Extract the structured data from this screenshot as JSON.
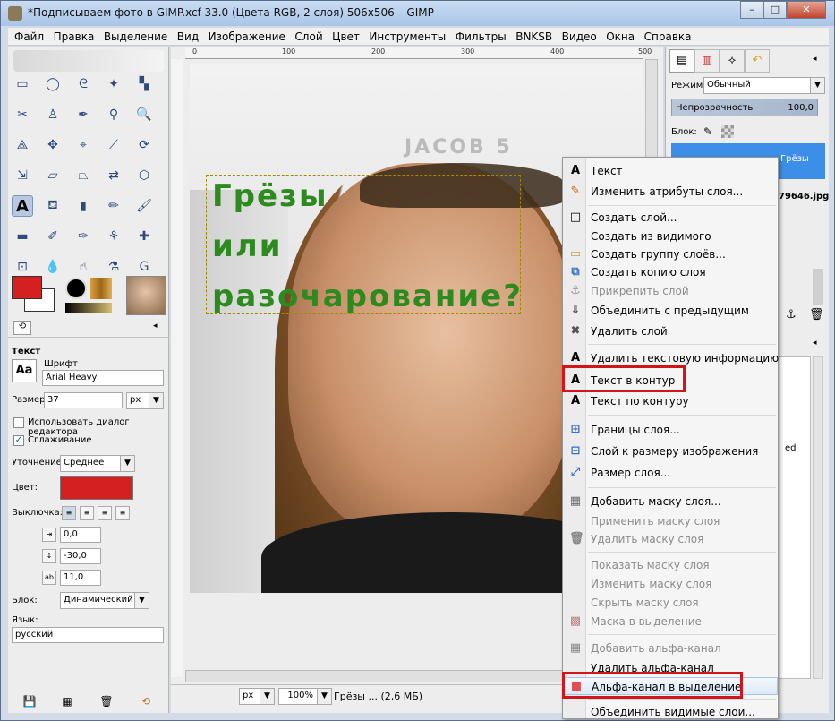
{
  "window": {
    "title": "*Подписываем фото в GIMP.xcf-33.0 (Цвета RGB, 2 слоя) 506x506 – GIMP",
    "min_label": "–",
    "max_label": "□",
    "close_label": "✕"
  },
  "menubar": [
    "Файл",
    "Правка",
    "Выделение",
    "Вид",
    "Изображение",
    "Слой",
    "Цвет",
    "Инструменты",
    "Фильтры",
    "BNKSB",
    "Видео",
    "Окна",
    "Справка"
  ],
  "tool_options": {
    "section": "Текст",
    "font_label": "Шрифт",
    "font_value": "Arial Heavy",
    "font_sample": "Aa",
    "size_label": "Размер:",
    "size_value": "37",
    "size_unit": "px",
    "use_editor_label": "Использовать диалог редактора",
    "antialias_label": "Сглаживание",
    "antialias_check": "✓",
    "hinting_label": "Уточнение:",
    "hinting_value": "Среднее",
    "color_label": "Цвет:",
    "color_value": "#d42020",
    "justify_label": "Выключка:",
    "indent_value": "0,0",
    "line_spacing_value": "-30,0",
    "letter_spacing_value": "11,0",
    "box_label": "Блок:",
    "box_value": "Динамический",
    "language_label": "Язык:",
    "language_value": "русский"
  },
  "canvas": {
    "ruler_marks": [
      "0",
      "100",
      "200",
      "300",
      "400",
      "500"
    ],
    "text_lines": [
      "Грёзы",
      "или",
      "разочарование?"
    ],
    "bg_text": "JACOB 5"
  },
  "statusbar": {
    "unit": "px",
    "zoom": "100%",
    "info": "Грёзы ... (2,6 МБ)"
  },
  "right_panel": {
    "mode_label": "Режим:",
    "mode_value": "Обычный",
    "opacity_label": "Непрозрачность",
    "opacity_value": "100,0",
    "lock_label": "Блок:",
    "layer1_name": "Грёзы",
    "layer2_name": "79646.jpg",
    "partial_text": "ed"
  },
  "context_menu": {
    "items": [
      {
        "label": "Текст",
        "icon": "A",
        "disabled": false
      },
      {
        "label": "Изменить атрибуты слоя...",
        "icon": "✎",
        "disabled": false
      },
      {
        "label": "Создать слой...",
        "icon": "□",
        "disabled": false
      },
      {
        "label": "Создать из видимого",
        "icon": "",
        "disabled": false
      },
      {
        "label": "Создать группу слоёв...",
        "icon": "▭",
        "disabled": false
      },
      {
        "label": "Создать копию слоя",
        "icon": "⧉",
        "disabled": false
      },
      {
        "label": "Прикрепить слой",
        "icon": "⚓",
        "disabled": true
      },
      {
        "label": "Объединить с предыдущим",
        "icon": "⇓",
        "disabled": false
      },
      {
        "label": "Удалить слой",
        "icon": "✖",
        "disabled": false
      },
      {
        "label": "Удалить текстовую информацию",
        "icon": "A",
        "disabled": false
      },
      {
        "label": "Текст в контур",
        "icon": "A",
        "disabled": false
      },
      {
        "label": "Текст по контуру",
        "icon": "A",
        "disabled": false
      },
      {
        "label": "Границы слоя...",
        "icon": "⊞",
        "disabled": false
      },
      {
        "label": "Слой к размеру изображения",
        "icon": "⊟",
        "disabled": false
      },
      {
        "label": "Размер слоя...",
        "icon": "⤢",
        "disabled": false
      },
      {
        "label": "Добавить маску слоя...",
        "icon": "▦",
        "disabled": false
      },
      {
        "label": "Применить маску слоя",
        "icon": "",
        "disabled": true
      },
      {
        "label": "Удалить маску слоя",
        "icon": "🗑",
        "disabled": true
      },
      {
        "label": "Показать маску слоя",
        "icon": "",
        "disabled": true
      },
      {
        "label": "Изменить маску слоя",
        "icon": "",
        "disabled": true
      },
      {
        "label": "Скрыть маску слоя",
        "icon": "",
        "disabled": true
      },
      {
        "label": "Маска в выделение",
        "icon": "▩",
        "disabled": true
      },
      {
        "label": "Добавить альфа-канал",
        "icon": "▦",
        "disabled": true
      },
      {
        "label": "Удалить альфа-канал",
        "icon": "",
        "disabled": false
      },
      {
        "label": "Альфа-канал в выделение",
        "icon": "■",
        "disabled": false
      },
      {
        "label": "Объединить видимые слои...",
        "icon": "",
        "disabled": false
      }
    ]
  },
  "colors": {
    "highlight": "#d0151b",
    "text_green": "#2d8a1e",
    "fg_color": "#d42020"
  }
}
